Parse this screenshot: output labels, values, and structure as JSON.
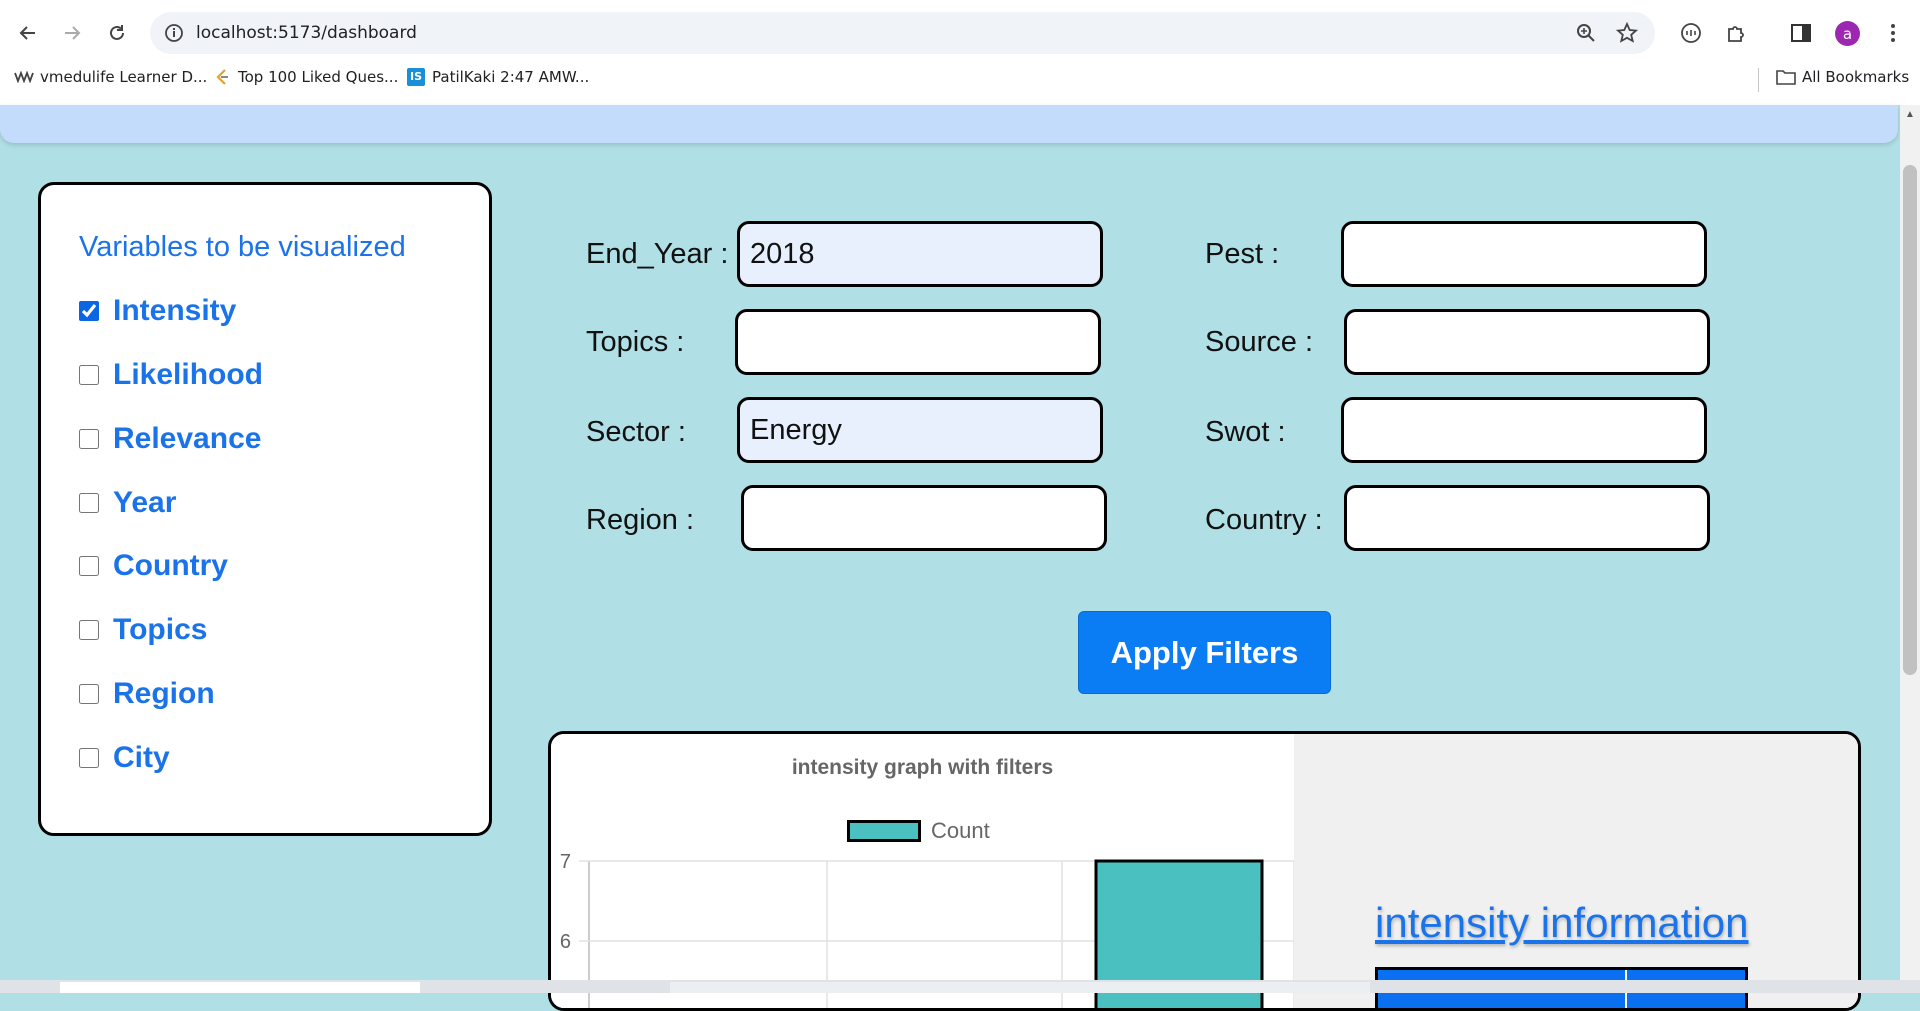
{
  "browser": {
    "url": "localhost:5173/dashboard",
    "avatar_letter": "a",
    "bookmarks": [
      {
        "label": "vmedulife Learner D...",
        "icon": "vmedulife-icon"
      },
      {
        "label": "Top 100 Liked Ques...",
        "icon": "leetcode-icon"
      },
      {
        "label": "PatilKaki 2:47 AMW...",
        "icon": "is-icon"
      }
    ],
    "all_bookmarks": "All Bookmarks"
  },
  "variables": {
    "heading": "Variables to be visualized",
    "items": [
      {
        "label": "Intensity",
        "checked": true
      },
      {
        "label": "Likelihood",
        "checked": false
      },
      {
        "label": "Relevance",
        "checked": false
      },
      {
        "label": "Year",
        "checked": false
      },
      {
        "label": "Country",
        "checked": false
      },
      {
        "label": "Topics",
        "checked": false
      },
      {
        "label": "Region",
        "checked": false
      },
      {
        "label": "City",
        "checked": false
      }
    ]
  },
  "filters": {
    "end_year": {
      "label": "End_Year :",
      "value": "2018"
    },
    "topics": {
      "label": "Topics :",
      "value": ""
    },
    "sector": {
      "label": "Sector :",
      "value": "Energy"
    },
    "region": {
      "label": "Region :",
      "value": ""
    },
    "pest": {
      "label": "Pest :",
      "value": ""
    },
    "source": {
      "label": "Source :",
      "value": ""
    },
    "swot": {
      "label": "Swot :",
      "value": ""
    },
    "country": {
      "label": "Country :",
      "value": ""
    },
    "apply_label": "Apply Filters"
  },
  "chart_data": {
    "type": "bar",
    "title": "intensity graph with filters",
    "series": [
      {
        "name": "Count",
        "color": "#4bc0c0"
      }
    ],
    "y_ticks_visible": [
      7,
      6
    ],
    "visible_bar_value": 7
  },
  "info": {
    "link_label": "intensity information"
  }
}
